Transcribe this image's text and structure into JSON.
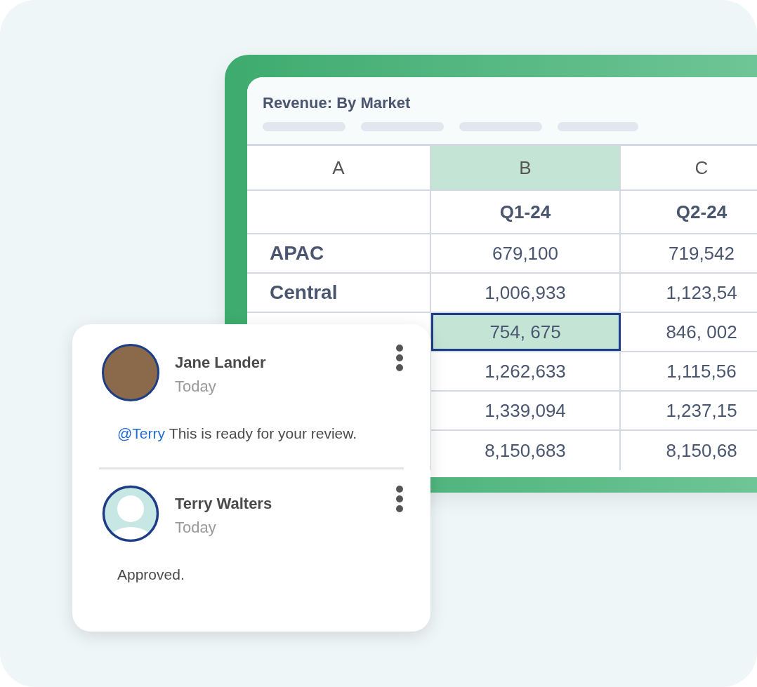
{
  "sheet": {
    "title": "Revenue: By Market",
    "row_header_column": {
      "label": "A"
    },
    "columns": [
      {
        "label": "B",
        "selected": true,
        "quarter": "Q1-24"
      },
      {
        "label": "C",
        "selected": false,
        "quarter": "Q2-24"
      }
    ],
    "rows": [
      {
        "market": "APAC",
        "cells": [
          {
            "text": "679,100",
            "selected": false
          },
          {
            "text": "719,542",
            "selected": false
          }
        ]
      },
      {
        "market": "Central",
        "cells": [
          {
            "text": "1,006,933",
            "selected": false
          },
          {
            "text": "1,123,54",
            "selected": false
          }
        ]
      },
      {
        "cells": [
          {
            "text": "754, 675",
            "selected": true
          },
          {
            "text": "846, 002",
            "selected": false
          }
        ]
      },
      {
        "cells": [
          {
            "text": "1,262,633",
            "selected": false
          },
          {
            "text": "1,115,56",
            "selected": false
          }
        ]
      },
      {
        "cells": [
          {
            "text": "1,339,094",
            "selected": false
          },
          {
            "text": "1,237,15",
            "selected": false
          }
        ]
      },
      {
        "cells": [
          {
            "text": "8,150,683",
            "selected": false
          },
          {
            "text": "8,150,68",
            "selected": false
          }
        ]
      }
    ]
  },
  "comments": [
    {
      "author": "Jane Lander",
      "time": "Today",
      "avatar": {
        "kind": "photo"
      },
      "mention": "@Terry",
      "text": "This is ready for your review."
    },
    {
      "author": "Terry Walters",
      "time": "Today",
      "avatar": {
        "kind": "placeholder"
      },
      "text": "Approved."
    }
  ]
}
